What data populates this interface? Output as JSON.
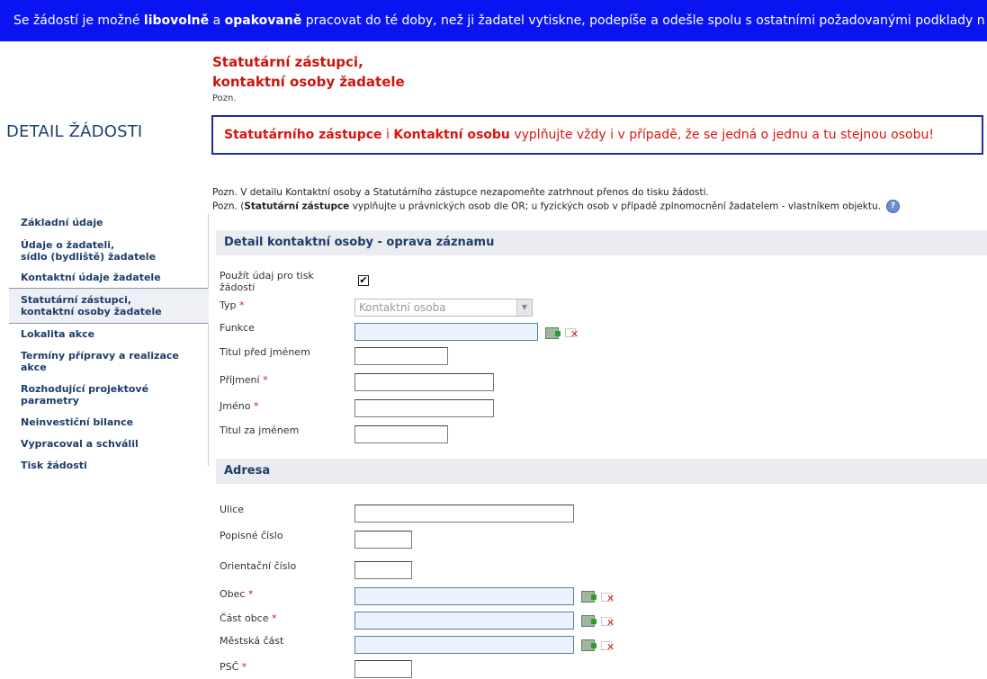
{
  "banner": {
    "text_1": "Se žádostí je možné ",
    "bold_1": "libovolně",
    "text_2": " a ",
    "bold_2": "opakovaně",
    "text_3": " pracovat do té doby, než ji žadatel vytiskne, podepíše a odešle spolu s ostatními požadovanými podklady n"
  },
  "detail_title": "DETAIL ŽÁDOSTI",
  "page_title_line1": "Statutární zástupci,",
  "page_title_line2": "kontaktní osoby žadatele",
  "page_pozn": "Pozn.",
  "warning": {
    "bold_1": "Statutárního zástupce",
    "text_1": " i ",
    "bold_2": "Kontaktní osobu",
    "text_2": " vyplňujte vždy i v případě, že se jedná o jednu a tu stejnou osobu!"
  },
  "notes": {
    "line1": "Pozn. V detailu Kontaktní osoby a Statutárního zástupce nezapomeňte zatrhnout přenos do tisku žádosti.",
    "line2_a": "Pozn. (",
    "line2_bold": "Statutární zástupce",
    "line2_b": " vyplňujte u právnických osob dle OR; u fyzických osob v případě zplnomocnění žadatelem - vlastníkem objektu."
  },
  "sidebar": {
    "items": [
      {
        "label": "Základní údaje"
      },
      {
        "label": "Údaje o žadateli,\nsídlo (bydliště) žadatele"
      },
      {
        "label": "Kontaktní údaje žadatele"
      },
      {
        "label": "Statutární zástupci,\nkontaktní osoby žadatele"
      },
      {
        "label": "Lokalita akce"
      },
      {
        "label": "Termíny přípravy a realizace akce"
      },
      {
        "label": "Rozhodující projektové parametry"
      },
      {
        "label": "Neinvestiční bilance"
      },
      {
        "label": "Vypracoval a schválil"
      },
      {
        "label": "Tisk žádosti"
      }
    ]
  },
  "form": {
    "section_title": "Detail kontaktní osoby - oprava záznamu",
    "print_label": "Použít údaj pro tisk žádosti",
    "print_checked": "✔",
    "typ_label": "Typ",
    "typ_value": "Kontaktní osoba",
    "funkce_label": "Funkce",
    "titul_pred_label": "Titul před jménem",
    "prijmeni_label": "Příjmení",
    "jmeno_label": "Jméno",
    "titul_za_label": "Titul za jménem",
    "required_mark": "*"
  },
  "address": {
    "section_title": "Adresa",
    "ulice_label": "Ulice",
    "popisne_label": "Popisné číslo",
    "orientacni_label": "Orientační číslo",
    "obec_label": "Obec",
    "cast_obce_label": "Část obce",
    "mestska_cast_label": "Městská část",
    "psc_label": "PSČ"
  },
  "icons": {
    "help": "question-mark-icon",
    "pick": "select-from-list-icon",
    "clear": "clear-field-icon"
  },
  "colors": {
    "banner_bg": "#0a14f0",
    "accent_red": "#c8160f",
    "nav_blue": "#1d3d6a"
  }
}
